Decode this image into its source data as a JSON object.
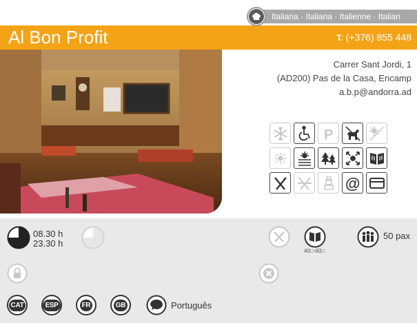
{
  "cuisine": {
    "text": "Italiana · Italiana · Italienne · Italian",
    "icon": "chef-hat-icon"
  },
  "header": {
    "title": "Al Bon Profit",
    "phone_prefix": "T.",
    "phone": "(+376) 855 448"
  },
  "address": {
    "line1": "Carrer Sant Jordi, 1",
    "line2": "(AD200) Pas de la Casa, Encamp",
    "email": "a.b.p@andorra.ad"
  },
  "services": [
    {
      "name": "air-conditioning-icon",
      "active": false
    },
    {
      "name": "wheelchair-access-icon",
      "active": true
    },
    {
      "name": "parking-icon",
      "active": false
    },
    {
      "name": "pets-allowed-icon",
      "active": true
    },
    {
      "name": "terrace-icon",
      "active": false
    },
    {
      "name": "sun-terrace-icon",
      "active": false
    },
    {
      "name": "window-view-icon",
      "active": true
    },
    {
      "name": "mountain-forest-icon",
      "active": true
    },
    {
      "name": "large-space-icon",
      "active": true
    },
    {
      "name": "menu-book-icon",
      "active": true
    },
    {
      "name": "restaurant-cutlery-icon",
      "active": true
    },
    {
      "name": "no-cutlery-icon",
      "active": false
    },
    {
      "name": "chef-icon",
      "active": false
    },
    {
      "name": "email-at-icon",
      "active": true
    },
    {
      "name": "credit-card-icon",
      "active": true
    }
  ],
  "hours": {
    "open": "08.30 h",
    "close": "23.30 h"
  },
  "price": {
    "label": "40□-60□"
  },
  "capacity": {
    "label": "50 pax"
  },
  "languages": {
    "cat": "CAT",
    "esp": "ESP",
    "fr": "FR",
    "gb": "GB",
    "other": "Português"
  }
}
